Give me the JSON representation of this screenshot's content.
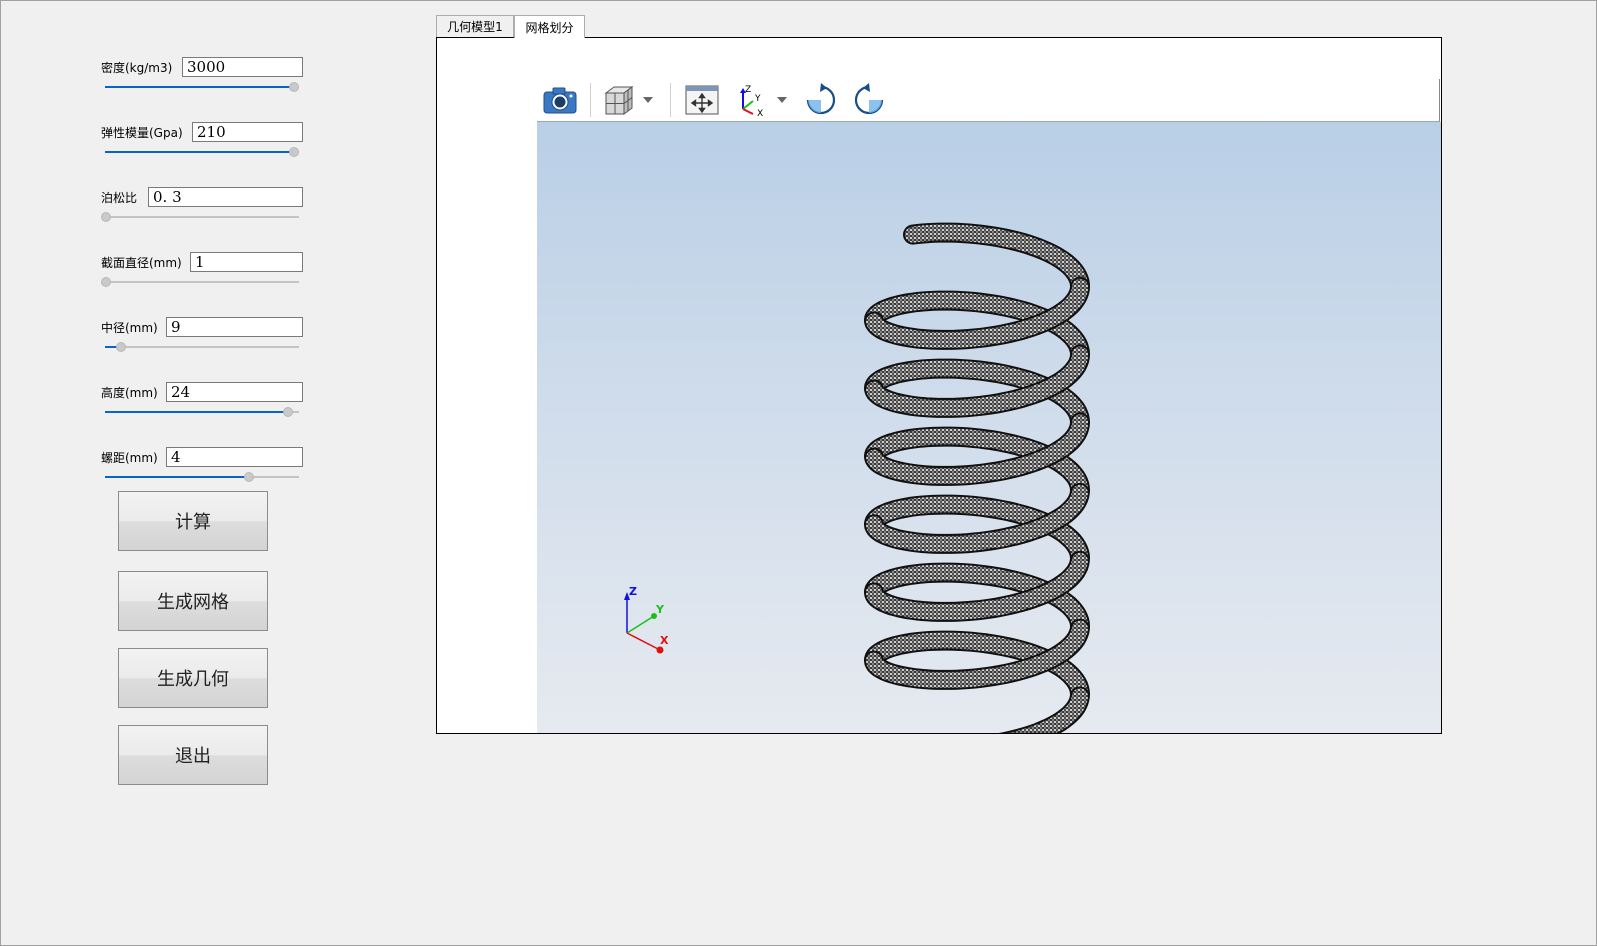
{
  "params": [
    {
      "label": "密度(kg/m3)",
      "value": "3000",
      "slider_fraction": 1.0
    },
    {
      "label": "弹性模量(Gpa)",
      "value": "210",
      "slider_fraction": 1.0
    },
    {
      "label": "泊松比",
      "value": "0. 3",
      "slider_fraction": 0.0
    },
    {
      "label": "截面直径(mm)",
      "value": "1",
      "slider_fraction": 0.0
    },
    {
      "label": "中径(mm)",
      "value": "9",
      "slider_fraction": 0.08
    },
    {
      "label": "高度(mm)",
      "value": "24",
      "slider_fraction": 0.97
    },
    {
      "label": "螺距(mm)",
      "value": "4",
      "slider_fraction": 0.76
    }
  ],
  "buttons": {
    "compute": "计算",
    "generate_mesh": "生成网格",
    "generate_geometry": "生成几何",
    "exit": "退出"
  },
  "tabs": [
    {
      "label": "几何模型1",
      "active": false
    },
    {
      "label": "网格划分",
      "active": true
    }
  ],
  "toolbar": {
    "icons": [
      "camera-icon",
      "view-cube-icon",
      "fit-all-icon",
      "axis-orientation-icon",
      "rotate-clockwise-icon",
      "rotate-counterclockwise-icon"
    ]
  },
  "axis_triad": {
    "z": "Z",
    "y": "Y",
    "x": "X"
  },
  "toolbar_axis": {
    "z": "Z",
    "y": "Y",
    "x": "X"
  },
  "colors": {
    "slider_fill": "#0a64c8",
    "axis_z": "#1010e0",
    "axis_y": "#18c018",
    "axis_x": "#e01010",
    "spring_mesh": "#2a2a2a",
    "viewport_top": "#b9cfe6",
    "viewport_bottom": "#e6eaf0"
  }
}
